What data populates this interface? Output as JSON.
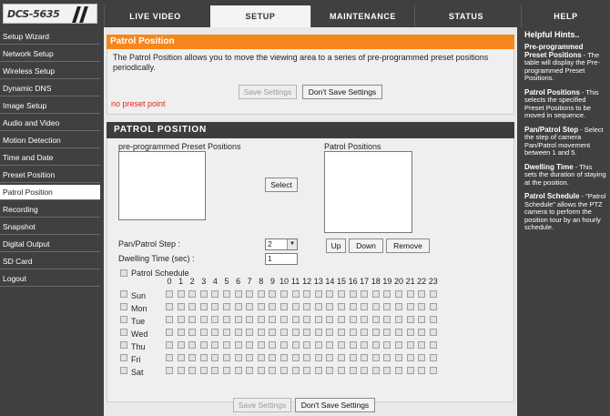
{
  "brand": {
    "model": "DCS-5635"
  },
  "nav": {
    "tabs": [
      {
        "label": "LIVE VIDEO"
      },
      {
        "label": "SETUP"
      },
      {
        "label": "MAINTENANCE"
      },
      {
        "label": "STATUS"
      },
      {
        "label": "HELP"
      }
    ],
    "active": "SETUP"
  },
  "sidebar": {
    "items": [
      {
        "label": "Setup Wizard"
      },
      {
        "label": "Network Setup"
      },
      {
        "label": "Wireless Setup"
      },
      {
        "label": "Dynamic DNS"
      },
      {
        "label": "Image Setup"
      },
      {
        "label": "Audio and Video"
      },
      {
        "label": "Motion Detection"
      },
      {
        "label": "Time and Date"
      },
      {
        "label": "Preset Position"
      },
      {
        "label": "Patrol Position"
      },
      {
        "label": "Recording"
      },
      {
        "label": "Snapshot"
      },
      {
        "label": "Digital Output"
      },
      {
        "label": "SD Card"
      },
      {
        "label": "Logout"
      }
    ],
    "active": "Patrol Position"
  },
  "info": {
    "title": "Patrol Position",
    "description": "The Patrol Position allows you to move the viewing area to a series of pre-programmed preset positions periodically.",
    "save_label": "Save Settings",
    "dont_save_label": "Don't Save Settings",
    "warning": "no preset point"
  },
  "patrol": {
    "title": "PATROL POSITION",
    "preset_list_label": "pre-programmed Preset Positions",
    "patrol_list_label": "Patrol Positions",
    "select_label": "Select",
    "up_label": "Up",
    "down_label": "Down",
    "remove_label": "Remove",
    "step_label": "Pan/Patrol Step :",
    "step_value": "2",
    "dwell_label": "Dwelling Time (sec) :",
    "dwell_value": "1",
    "schedule_label": "Patrol Schedule",
    "hours": [
      "0",
      "1",
      "2",
      "3",
      "4",
      "5",
      "6",
      "7",
      "8",
      "9",
      "10",
      "11",
      "12",
      "13",
      "14",
      "15",
      "16",
      "17",
      "18",
      "19",
      "20",
      "21",
      "22",
      "23"
    ],
    "days": [
      "Sun",
      "Mon",
      "Tue",
      "Wed",
      "Thu",
      "Fri",
      "Sat"
    ]
  },
  "footer": {
    "save_label": "Save Settings",
    "dont_save_label": "Don't Save Settings"
  },
  "help": {
    "title": "Helpful Hints..",
    "entries": [
      {
        "term": "Pre-programmed Preset Positions",
        "text": " - The table will display the Pre-programmed Preset Positions."
      },
      {
        "term": "Patrol Positions",
        "text": " - This selects the specified Preset Positions to be moved in sequence."
      },
      {
        "term": "Pan/Patrol Step",
        "text": " - Select the step of camera Pan/Patrol movement between 1 and 5."
      },
      {
        "term": "Dwelling Time",
        "text": " - This sets the duration of staying at the position."
      },
      {
        "term": "Patrol Schedule",
        "text": " - \"Patrol Schedule\" allows the PTZ camera to perform the position tour by an hourly schedule."
      }
    ]
  },
  "colors": {
    "accent_orange": "#f7861c",
    "dark_bg": "#404040",
    "warning_red": "#e0281e"
  }
}
